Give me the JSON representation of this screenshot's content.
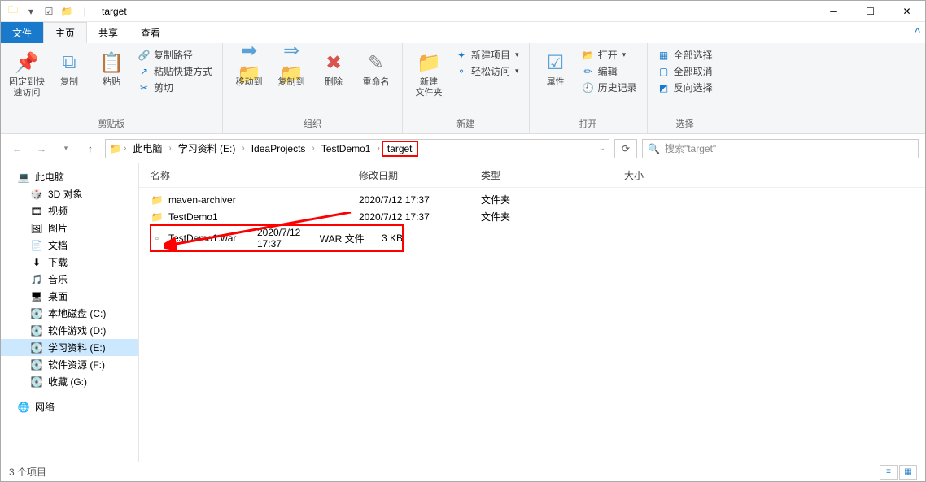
{
  "title": "target",
  "tabs": {
    "file": "文件",
    "home": "主页",
    "share": "共享",
    "view": "查看"
  },
  "ribbon": {
    "pin": "固定到快\n速访问",
    "copy": "复制",
    "paste": "粘贴",
    "copypath": "复制路径",
    "pasteshort": "粘贴快捷方式",
    "cut": "剪切",
    "clipboard": "剪贴板",
    "moveto": "移动到",
    "copyto": "复制到",
    "delete": "删除",
    "rename": "重命名",
    "organize": "组织",
    "newfolder": "新建\n文件夹",
    "newitem": "新建项目",
    "easyaccess": "轻松访问",
    "new": "新建",
    "properties": "属性",
    "open": "打开",
    "edit": "编辑",
    "history": "历史记录",
    "opengrp": "打开",
    "selectall": "全部选择",
    "selectnone": "全部取消",
    "invert": "反向选择",
    "select": "选择"
  },
  "breadcrumb": [
    "此电脑",
    "学习资料 (E:)",
    "IdeaProjects",
    "TestDemo1",
    "target"
  ],
  "search_placeholder": "搜索\"target\"",
  "tree": [
    {
      "label": "此电脑",
      "icon": "pc",
      "sub": false
    },
    {
      "label": "3D 对象",
      "icon": "3d",
      "sub": true
    },
    {
      "label": "视频",
      "icon": "video",
      "sub": true
    },
    {
      "label": "图片",
      "icon": "pic",
      "sub": true
    },
    {
      "label": "文档",
      "icon": "doc",
      "sub": true
    },
    {
      "label": "下载",
      "icon": "dl",
      "sub": true
    },
    {
      "label": "音乐",
      "icon": "music",
      "sub": true
    },
    {
      "label": "桌面",
      "icon": "desk",
      "sub": true
    },
    {
      "label": "本地磁盘 (C:)",
      "icon": "drive",
      "sub": true
    },
    {
      "label": "软件游戏 (D:)",
      "icon": "drive",
      "sub": true
    },
    {
      "label": "学习资料 (E:)",
      "icon": "drive",
      "sub": true,
      "selected": true
    },
    {
      "label": "软件资源 (F:)",
      "icon": "drive",
      "sub": true
    },
    {
      "label": "收藏 (G:)",
      "icon": "drive",
      "sub": true
    },
    {
      "label": "网络",
      "icon": "net",
      "sub": false
    }
  ],
  "columns": {
    "name": "名称",
    "date": "修改日期",
    "type": "类型",
    "size": "大小"
  },
  "files": [
    {
      "name": "maven-archiver",
      "date": "2020/7/12 17:37",
      "type": "文件夹",
      "size": "",
      "icon": "folder"
    },
    {
      "name": "TestDemo1",
      "date": "2020/7/12 17:37",
      "type": "文件夹",
      "size": "",
      "icon": "folder"
    },
    {
      "name": "TestDemo1.war",
      "date": "2020/7/12 17:37",
      "type": "WAR 文件",
      "size": "3 KB",
      "icon": "file",
      "highlight": true
    }
  ],
  "status": "3 个项目"
}
